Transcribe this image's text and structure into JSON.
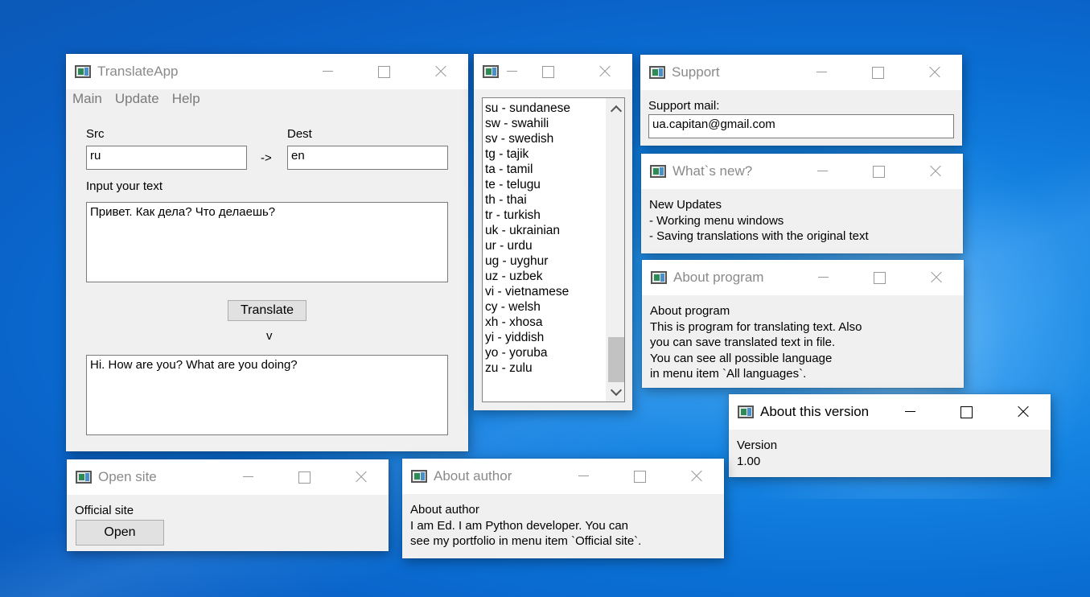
{
  "main_window": {
    "title": "TranslateApp",
    "menu": [
      "Main",
      "Update",
      "Help"
    ],
    "src_label": "Src",
    "src_value": "ru",
    "arrow": "->",
    "dest_label": "Dest",
    "dest_value": "en",
    "input_label": "Input your text",
    "input_text": "Привет. Как дела? Что делаешь?",
    "translate_button": "Translate",
    "down_marker": "v",
    "output_text": "Hi. How are you? What are you doing?"
  },
  "languages_window": {
    "title": "",
    "items": [
      "su - sundanese",
      "sw - swahili",
      "sv - swedish",
      "tg - tajik",
      "ta - tamil",
      "te - telugu",
      "th - thai",
      "tr - turkish",
      "uk - ukrainian",
      "ur - urdu",
      "ug - uyghur",
      "uz - uzbek",
      "vi - vietnamese",
      "cy - welsh",
      "xh - xhosa",
      "yi - yiddish",
      "yo - yoruba",
      "zu - zulu"
    ],
    "scroll_position": 1.0
  },
  "support_window": {
    "title": "Support",
    "label": "Support mail:",
    "email": "ua.capitan@gmail.com"
  },
  "whats_new_window": {
    "title": "What`s new?",
    "text": "New Updates\n- Working menu windows\n- Saving translations with the original text"
  },
  "about_program_window": {
    "title": "About program",
    "text": "About program\nThis is program for translating text. Also\nyou can save translated text in file.\nYou can see all possible language\nin menu item `All languages`."
  },
  "about_version_window": {
    "title": "About this version",
    "text": "Version\n1.00"
  },
  "open_site_window": {
    "title": "Open site",
    "label": "Official site",
    "button": "Open"
  },
  "about_author_window": {
    "title": "About author",
    "text": "About author\nI am Ed. I am Python developer. You can\nsee my portfolio in menu item `Official site`."
  }
}
